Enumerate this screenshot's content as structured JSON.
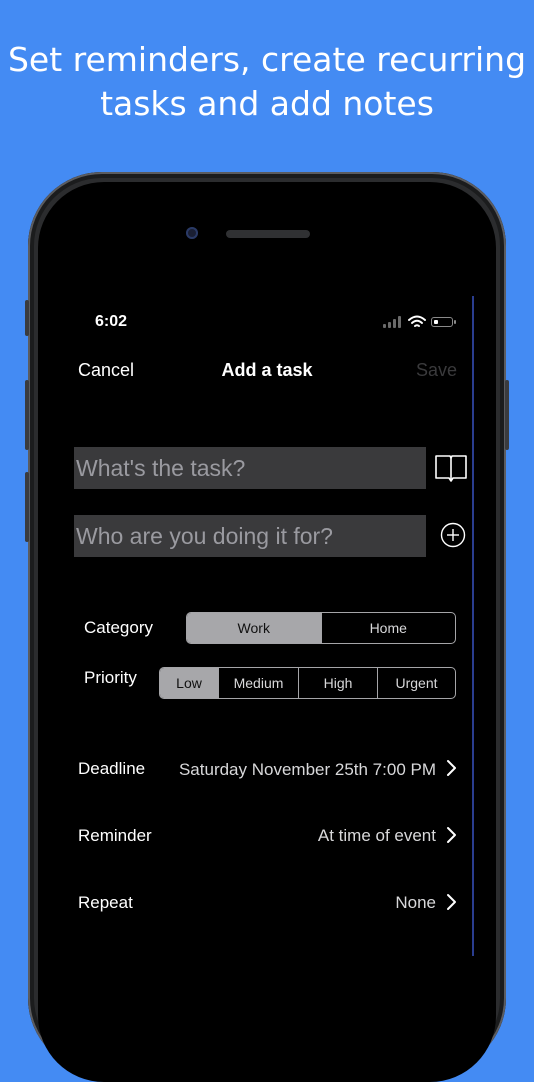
{
  "headline": {
    "line1": "Set reminders, create recurring",
    "line2": "tasks and add notes"
  },
  "status_bar": {
    "time": "6:02"
  },
  "nav": {
    "cancel": "Cancel",
    "title": "Add a task",
    "save": "Save"
  },
  "form": {
    "task_placeholder": "What's the task?",
    "who_placeholder": "Who are you doing it for?",
    "category": {
      "label": "Category",
      "options": [
        "Work",
        "Home"
      ],
      "selected": "Work"
    },
    "priority": {
      "label": "Priority",
      "options": [
        "Low",
        "Medium",
        "High",
        "Urgent"
      ],
      "selected": "Low"
    }
  },
  "details": {
    "deadline": {
      "label": "Deadline",
      "value": "Saturday November 25th 7:00 PM"
    },
    "reminder": {
      "label": "Reminder",
      "value": "At time of event"
    },
    "repeat": {
      "label": "Repeat",
      "value": "None"
    }
  },
  "colors": {
    "background": "#448bf3",
    "field": "#3a3a3c",
    "segment_active": "#a7a7aa"
  },
  "icons": [
    "book-icon",
    "plus-circle-icon",
    "chevron-right-icon",
    "signal-icon",
    "wifi-icon",
    "battery-icon"
  ]
}
